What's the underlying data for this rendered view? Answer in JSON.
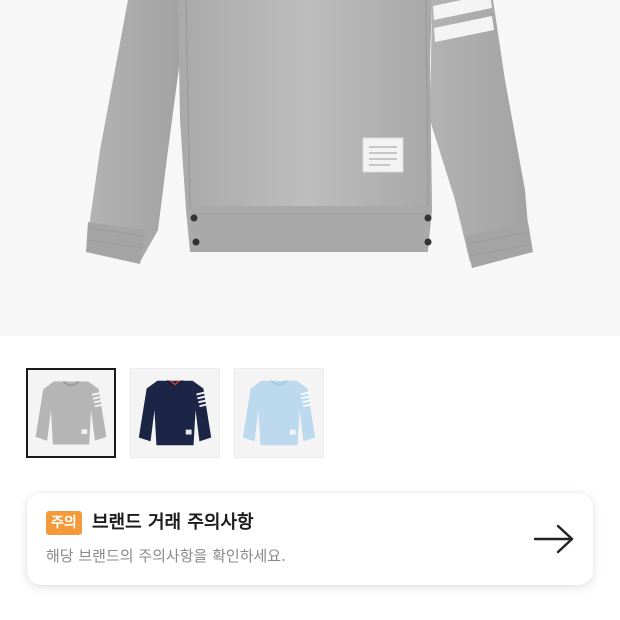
{
  "product_images": {
    "main_image": "grey crewneck sweatshirt with four white stripes on sleeve",
    "thumbnails": [
      {
        "color_name": "grey",
        "swatch": "#b7b7b7",
        "selected": true
      },
      {
        "color_name": "navy",
        "swatch": "#1d2547",
        "selected": false
      },
      {
        "color_name": "light-blue",
        "swatch": "#bcd9ee",
        "selected": false
      }
    ]
  },
  "notice": {
    "badge": "주의",
    "title": "브랜드 거래 주의사항",
    "subtitle": "해당 브랜드의 주의사항을 확인하세요.",
    "arrow_icon": "arrow-right-icon",
    "badge_color": "#f59a3b"
  }
}
